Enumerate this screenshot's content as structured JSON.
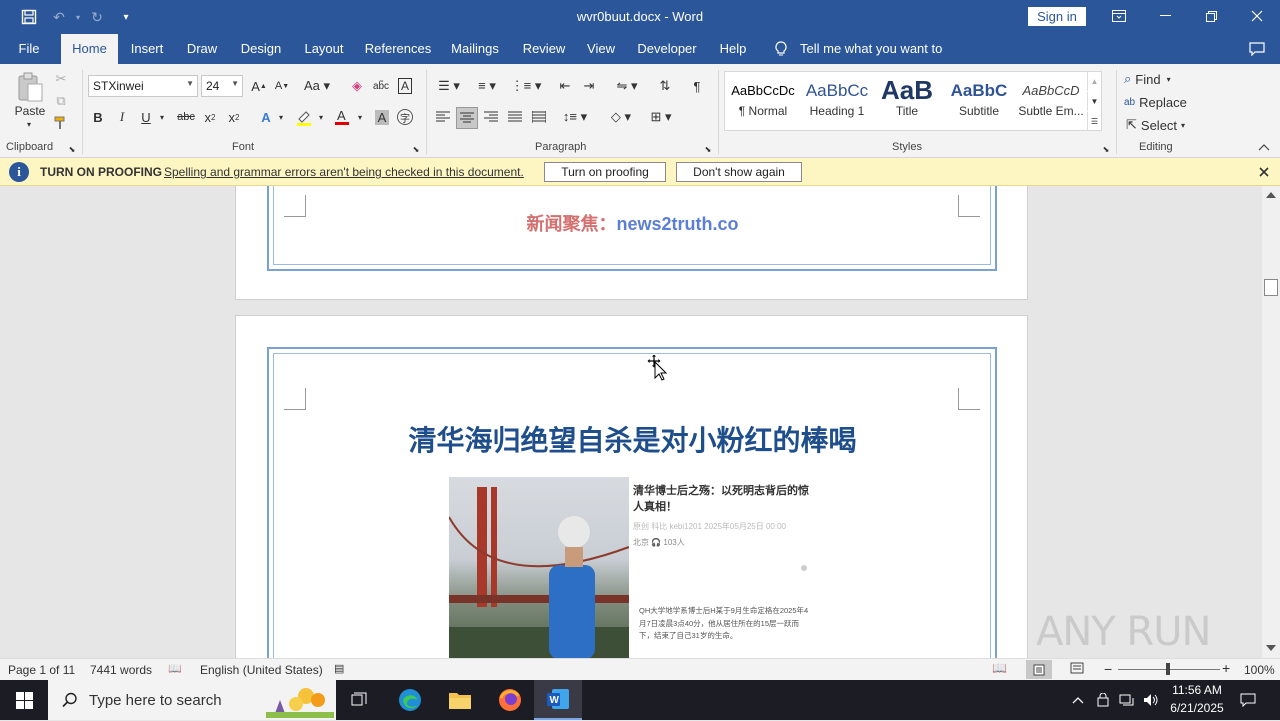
{
  "titlebar": {
    "title": "wvr0buut.docx  -  Word",
    "sign_in": "Sign in"
  },
  "tabs": [
    "File",
    "Home",
    "Insert",
    "Draw",
    "Design",
    "Layout",
    "References",
    "Mailings",
    "Review",
    "View",
    "Developer",
    "Help"
  ],
  "tell_me": "Tell me what you want to do",
  "ribbon": {
    "clipboard": {
      "label": "Clipboard",
      "paste": "Paste"
    },
    "font": {
      "label": "Font",
      "name": "STXinwei",
      "size": "24"
    },
    "paragraph": {
      "label": "Paragraph"
    },
    "styles": {
      "label": "Styles",
      "items": [
        {
          "preview": "AaBbCcDc",
          "name": "¶ Normal"
        },
        {
          "preview": "AaBbCc",
          "name": "Heading 1"
        },
        {
          "preview": "AaB",
          "name": "Title"
        },
        {
          "preview": "AaBbC",
          "name": "Subtitle"
        },
        {
          "preview": "AaBbCcD",
          "name": "Subtle Em..."
        }
      ]
    },
    "editing": {
      "label": "Editing",
      "find": "Find",
      "replace": "Replace",
      "select": "Select"
    }
  },
  "message_bar": {
    "title": "TURN ON PROOFING",
    "text": "Spelling and grammar errors aren't being checked in this document.",
    "button_on": "Turn on proofing",
    "button_dismiss": "Don't show again"
  },
  "document": {
    "footer_label": "新闻聚焦：",
    "footer_link": "news2truth.co",
    "heading": "清华海归绝望自杀是对小粉红的棒喝",
    "article_title": "清华博士后之殇：以死明志背后的惊人真相！",
    "article_meta_1": "原创  科比  kebi1201  2025年05月25日 00:00",
    "article_meta_2": "北京  🎧 103人",
    "article_body": "QH大学地学系博士后H某于9月生命定格在2025年4月7日凌晨3点40分，他从居住所在的15层一跃而下，结束了自己31岁的生命。"
  },
  "status": {
    "page": "Page 1 of 11",
    "words": "7441 words",
    "language": "English (United States)",
    "zoom": "100%"
  },
  "taskbar": {
    "search_placeholder": "Type here to search",
    "time": "11:56 AM",
    "date": "6/21/2025"
  },
  "watermark": "ANY RUN",
  "colors": {
    "word_blue": "#2b579a",
    "heading_blue": "#1f4e8c",
    "footer_red": "#c0504d"
  }
}
